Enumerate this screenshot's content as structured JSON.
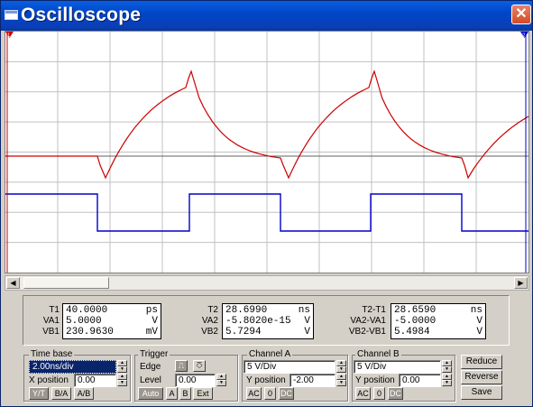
{
  "window": {
    "title": "Oscilloscope",
    "close_glyph": "✕",
    "icon": "window-icon"
  },
  "markers": {
    "t1": "1",
    "t2": "2"
  },
  "readouts": {
    "t1": {
      "label": "T1",
      "value": "40.0000",
      "unit": "ps"
    },
    "va1": {
      "label": "VA1",
      "value": "5.0000",
      "unit": "V"
    },
    "vb1": {
      "label": "VB1",
      "value": "230.9630",
      "unit": "mV"
    },
    "t2": {
      "label": "T2",
      "value": "28.6990",
      "unit": "ns"
    },
    "va2": {
      "label": "VA2",
      "value": "-5.8020e-15",
      "unit": "V"
    },
    "vb2": {
      "label": "VB2",
      "value": "5.7294",
      "unit": "V"
    },
    "t21": {
      "label": "T2-T1",
      "value": "28.6590",
      "unit": "ns"
    },
    "va21": {
      "label": "VA2-VA1",
      "value": "-5.0000",
      "unit": "V"
    },
    "vb21": {
      "label": "VB2-VB1",
      "value": "5.4984",
      "unit": "V"
    }
  },
  "timebase": {
    "title": "Time base",
    "scale": "2.00ns/div",
    "xpos_label": "X position",
    "xpos_value": "0.00",
    "modes": [
      "Y/T",
      "B/A",
      "A/B"
    ]
  },
  "trigger": {
    "title": "Trigger",
    "edge_label": "Edge",
    "level_label": "Level",
    "level_value": "0.00",
    "sources": [
      "Auto",
      "A",
      "B",
      "Ext"
    ]
  },
  "channel_a": {
    "title": "Channel A",
    "scale": "5 V/Div",
    "ypos_label": "Y position",
    "ypos_value": "-2.00",
    "coupling": [
      "AC",
      "0",
      "DC"
    ]
  },
  "channel_b": {
    "title": "Channel B",
    "scale": "5 V/Div",
    "ypos_label": "Y position",
    "ypos_value": "0.00",
    "coupling": [
      "AC",
      "0",
      "DC"
    ]
  },
  "buttons": {
    "reduce": "Reduce",
    "reverse": "Reverse",
    "save": "Save"
  },
  "colors": {
    "channel_a": "#cc0000",
    "channel_b": "#0000cc",
    "grid": "#c0c0c0",
    "marker_t1": "#cc0000",
    "marker_t2": "#0000cc"
  }
}
